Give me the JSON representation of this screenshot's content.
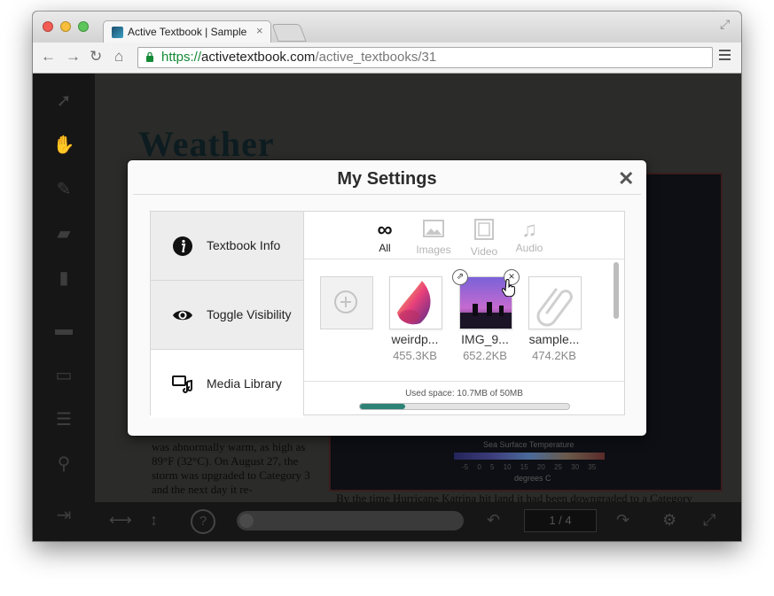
{
  "browser": {
    "tab_title": "Active Textbook | Sample",
    "tab_close": "×",
    "url_scheme": "https://",
    "url_host": "activetextbook.com",
    "url_path": "/active_textbooks/31"
  },
  "page": {
    "title": "Weather",
    "body_text": "was abnormally warm, as high as 89°F (32°C). On August 27, the storm was upgraded to Category 3 and the next day it re-",
    "caption": "By the time Hurricane Katrina hit land it had been downgraded to a Category",
    "sst_label": "Sea Surface Temperature",
    "sst_ticks": "-5 0 5 10 15 20 25 30 35",
    "sst_unit": "degrees C"
  },
  "viewer": {
    "page_indicator": "1 / 4",
    "help_label": "?"
  },
  "dialog": {
    "title": "My Settings",
    "close": "✕",
    "menu": [
      {
        "label": "Textbook Info"
      },
      {
        "label": "Toggle Visibility"
      },
      {
        "label": "Media Library"
      }
    ],
    "filters": [
      {
        "label": "All",
        "active": true
      },
      {
        "label": "Images",
        "active": false
      },
      {
        "label": "Video",
        "active": false
      },
      {
        "label": "Audio",
        "active": false
      }
    ],
    "media": [
      {
        "name": "weirdp...",
        "size": "455.3KB"
      },
      {
        "name": "IMG_9...",
        "size": "652.2KB"
      },
      {
        "name": "sample...",
        "size": "474.2KB"
      }
    ],
    "used_space": "Used space: 10.7MB of 50MB",
    "used_fraction": 0.214
  },
  "colors": {
    "accent": "#2d8276",
    "dialog_bg": "#fafafa",
    "url_green": "#138a36"
  }
}
